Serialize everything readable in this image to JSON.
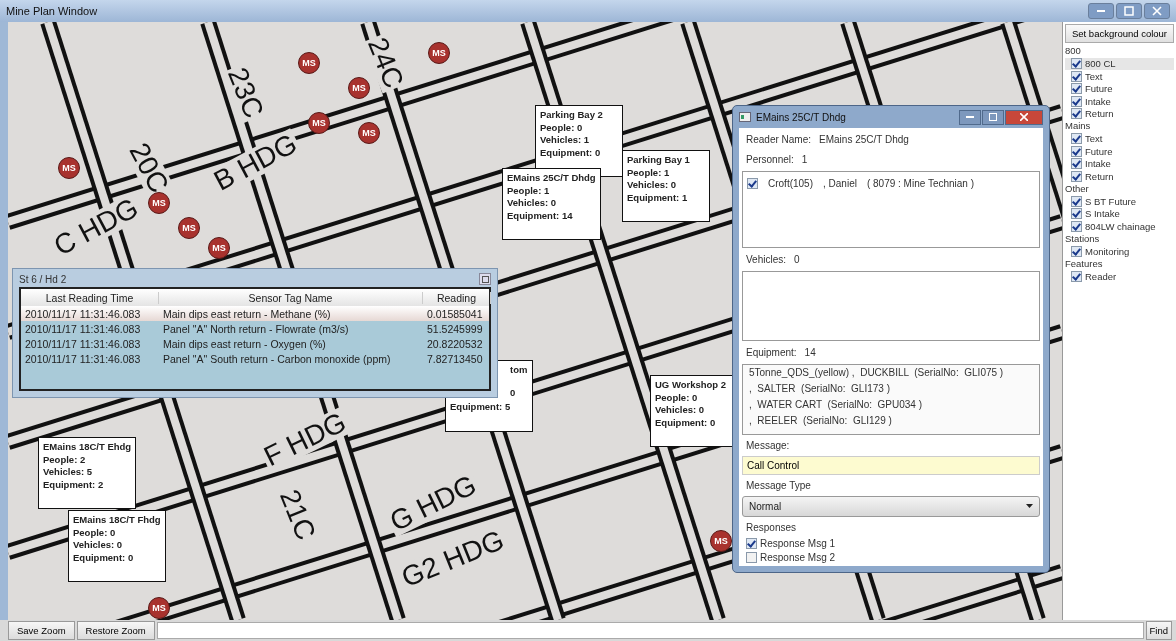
{
  "window": {
    "title": "Mine Plan Window"
  },
  "map": {
    "labels": [
      "20C",
      "24C",
      "23C",
      "B HDG",
      "C HDG",
      "F HDG",
      "21C",
      "G HDG",
      "G2 HDG"
    ],
    "markers": [
      "MS",
      "MS",
      "MS",
      "MS",
      "MS",
      "MS",
      "MS",
      "MS",
      "MS",
      "MS",
      "MS"
    ],
    "callouts": [
      {
        "title": "Parking Bay 2",
        "lines": [
          "People: 0",
          "Vehicles: 1",
          "Equipment: 0"
        ]
      },
      {
        "title": "Parking Bay 1",
        "lines": [
          "People: 1",
          "Vehicles: 0",
          "Equipment: 1"
        ]
      },
      {
        "title": "EMains 25C/T Dhdg",
        "lines": [
          "People: 1",
          "Vehicles: 0",
          "Equipment: 14"
        ]
      },
      {
        "title": "tom",
        "lines": [
          "0",
          "Equipment: 5"
        ]
      },
      {
        "title": "UG Workshop 2",
        "lines": [
          "People: 0",
          "Vehicles: 0",
          "Equipment: 0"
        ]
      },
      {
        "title": "EMains 18C/T Ehdg",
        "lines": [
          "People: 2",
          "Vehicles: 5",
          "Equipment: 2"
        ]
      },
      {
        "title": "EMains 18C/T Fhdg",
        "lines": [
          "People: 0",
          "Vehicles: 0",
          "Equipment: 0"
        ]
      }
    ]
  },
  "sensor_window": {
    "title": "St 6 / Hd 2",
    "columns": [
      "Last Reading Time",
      "Sensor Tag Name",
      "Reading"
    ],
    "rows": [
      {
        "cells": [
          "2010/11/17 11:31:46.083",
          "Main dips east return - Methane (%)",
          "0.01585041"
        ],
        "selected": true
      },
      {
        "cells": [
          "2010/11/17 11:31:46.083",
          "Panel \"A\" North return - Flowrate (m3/s)",
          "51.5245999"
        ],
        "selected": false
      },
      {
        "cells": [
          "2010/11/17 11:31:46.083",
          "Main dips east return - Oxygen (%)",
          "20.8220532"
        ],
        "selected": false
      },
      {
        "cells": [
          "2010/11/17 11:31:46.083",
          "Panel \"A\" South return - Carbon monoxide (ppm)",
          "7.82713450"
        ],
        "selected": false
      }
    ]
  },
  "reader_dialog": {
    "title": "EMains 25C/T Dhdg",
    "reader_label": "Reader Name:",
    "reader_name": "EMains 25C/T Dhdg",
    "personnel_label": "Personnel:",
    "personnel_count": "1",
    "personnel": [
      {
        "name": "Croft(105)",
        "first": ", Daniel",
        "role": "( 8079 : Mine Technian )",
        "checked": true
      }
    ],
    "vehicles_label": "Vehicles:",
    "vehicles_count": "0",
    "equipment_label": "Equipment:",
    "equipment_count": "14",
    "equipment": [
      "5Tonne_QDS_(yellow) ,  DUCKBILL  (SerialNo:  GLI075 )",
      ",  SALTER  (SerialNo:  GLI173 )",
      ",  WATER CART  (SerialNo:  GPU034 )",
      ",  REELER  (SerialNo:  GLI129 )"
    ],
    "message_label": "Message:",
    "message": "Call Control",
    "message_type_label": "Message Type",
    "message_type": "Normal",
    "responses_label": "Responses",
    "responses": [
      {
        "label": "Response Msg 1",
        "checked": true
      },
      {
        "label": "Response Msg 2",
        "checked": false
      }
    ]
  },
  "layers_panel": {
    "button": "Set background colour",
    "groups": [
      {
        "name": "800",
        "items": [
          {
            "label": "800 CL",
            "checked": true,
            "selected": true
          },
          {
            "label": "Text",
            "checked": true,
            "selected": false
          },
          {
            "label": "Future",
            "checked": true,
            "selected": false
          },
          {
            "label": "Intake",
            "checked": true,
            "selected": false
          },
          {
            "label": "Return",
            "checked": true,
            "selected": false
          }
        ]
      },
      {
        "name": "Mains",
        "items": [
          {
            "label": "Text",
            "checked": true,
            "selected": false
          },
          {
            "label": "Future",
            "checked": true,
            "selected": false
          },
          {
            "label": "Intake",
            "checked": true,
            "selected": false
          },
          {
            "label": "Return",
            "checked": true,
            "selected": false
          }
        ]
      },
      {
        "name": "Other",
        "items": [
          {
            "label": "S BT Future",
            "checked": true,
            "selected": false
          },
          {
            "label": "S Intake",
            "checked": true,
            "selected": false
          },
          {
            "label": "804LW chainage",
            "checked": true,
            "selected": false
          }
        ]
      },
      {
        "name": "Stations",
        "items": [
          {
            "label": "Monitoring",
            "checked": true,
            "selected": false
          }
        ]
      },
      {
        "name": "Features",
        "items": [
          {
            "label": "Reader",
            "checked": true,
            "selected": false
          }
        ]
      }
    ]
  },
  "bottom_bar": {
    "buttons": [
      "Save Zoom",
      "Restore Zoom"
    ],
    "find_button": "Find"
  }
}
